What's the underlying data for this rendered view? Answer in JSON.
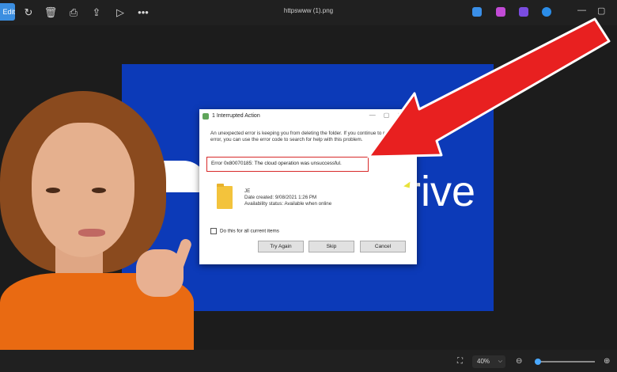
{
  "toolbar": {
    "edit_label": "Edit",
    "file_title": "httpswww (1).png",
    "icons": [
      "rotate-icon",
      "delete-icon",
      "print-icon",
      "share-icon",
      "slideshow-icon",
      "more-icon"
    ],
    "more_label": "•••"
  },
  "canvas": {
    "bg_color": "#0c3ab8",
    "brand_text": "rive"
  },
  "dialog": {
    "title": "1 Interrupted Action",
    "message": "An unexpected error is keeping you from deleting the folder. If you continue to receive this error, you can use the error code to search for help with this problem.",
    "error": "Error 0x80070185: The cloud operation was unsuccessful.",
    "folder_name": "JE",
    "date_created": "Date created: 9/08/2021 1:26 PM",
    "availability": "Availability status: Available when online",
    "checkbox_label": "Do this for all current items",
    "buttons": {
      "try_again": "Try Again",
      "skip": "Skip",
      "cancel": "Cancel"
    }
  },
  "statusbar": {
    "zoom_level": "40%",
    "zoom_fraction": 0.05
  },
  "colors": {
    "arrow": "#e82020",
    "error_outline": "#d82a2a",
    "accent": "#3b8ee0"
  }
}
